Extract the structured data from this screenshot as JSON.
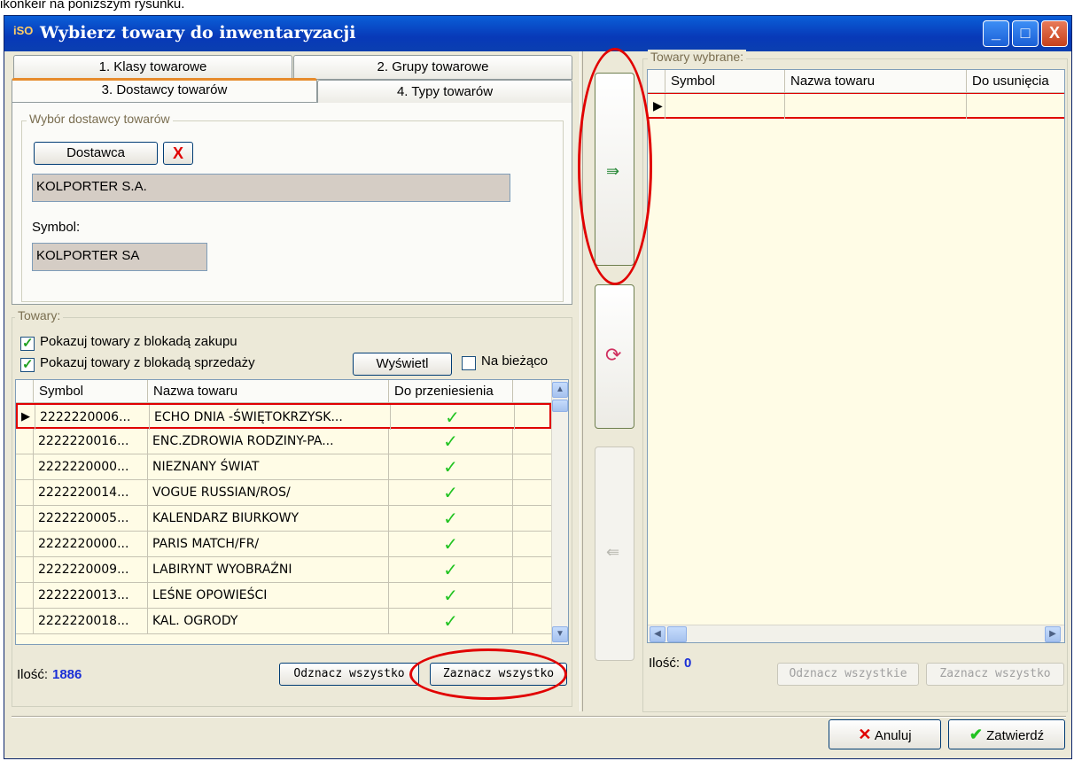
{
  "doc_text": "ikonkeir na poniższym rysunku.",
  "window": {
    "title": "Wybierz towary do inwentaryzacji",
    "icon": "iSO",
    "minimize": "_",
    "maximize": "□",
    "close": "X"
  },
  "tabs": [
    {
      "label": "1. Klasy towarowe"
    },
    {
      "label": "2. Grupy towarowe"
    },
    {
      "label": "3. Dostawcy towarów",
      "active": true
    },
    {
      "label": "4. Typy towarów"
    }
  ],
  "supplier": {
    "group_title": "Wybór dostawcy towarów",
    "button": "Dostawca",
    "clear": "X",
    "name": "KOLPORTER S.A.",
    "symbol_label": "Symbol:",
    "symbol": "KOLPORTER SA"
  },
  "towary": {
    "group_title": "Towary:",
    "chk_zakup": "Pokazuj towary z blokadą zakupu",
    "chk_sprzedaz": "Pokazuj towary z blokadą sprzedaży",
    "wyswietl": "Wyświetl",
    "na_biezaco": "Na bieżąco",
    "columns": [
      "Symbol",
      "Nazwa towaru",
      "Do przeniesienia"
    ],
    "rows": [
      {
        "symbol": "2222220006...",
        "name": "ECHO DNIA -ŚWIĘTOKRZYSK...",
        "check": "✓"
      },
      {
        "symbol": "2222220016...",
        "name": "ENC.ZDROWIA RODZINY-PA...",
        "check": "✓"
      },
      {
        "symbol": "2222220000...",
        "name": "NIEZNANY ŚWIAT",
        "check": "✓"
      },
      {
        "symbol": "2222220014...",
        "name": "VOGUE RUSSIAN/ROS/",
        "check": "✓"
      },
      {
        "symbol": "2222220005...",
        "name": "KALENDARZ BIURKOWY",
        "check": "✓"
      },
      {
        "symbol": "2222220000...",
        "name": "PARIS MATCH/FR/",
        "check": "✓"
      },
      {
        "symbol": "2222220009...",
        "name": "LABIRYNT WYOBRAŹNI",
        "check": "✓"
      },
      {
        "symbol": "2222220013...",
        "name": "LEŚNE OPOWIEŚCI",
        "check": "✓"
      },
      {
        "symbol": "2222220018...",
        "name": "KAL. OGRODY",
        "check": "✓"
      }
    ],
    "count_label": "Ilość:",
    "count": "1886",
    "unselect_all": "Odznacz wszystko",
    "select_all": "Zaznacz wszystko"
  },
  "selected": {
    "group_title": "Towary wybrane:",
    "columns": [
      "Symbol",
      "Nazwa towaru",
      "Do usunięcia"
    ],
    "count_label": "Ilość:",
    "count": "0",
    "unselect_all": "Odznacz wszystkie",
    "select_all": "Zaznacz wszystko"
  },
  "footer": {
    "cancel": "Anuluj",
    "confirm": "Zatwierdź"
  },
  "colors": {
    "titlebar": "#0839b8",
    "count": "#1a2fd6",
    "highlight": "#e10000",
    "check": "#21c321"
  }
}
